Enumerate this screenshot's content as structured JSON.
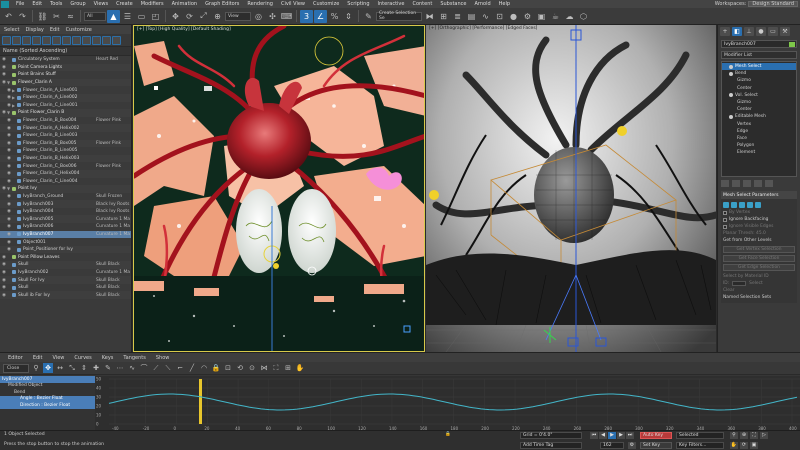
{
  "menubar": {
    "items": [
      "File",
      "Edit",
      "Tools",
      "Group",
      "Views",
      "Create",
      "Modifiers",
      "Animation",
      "Graph Editors",
      "Rendering",
      "Civil View",
      "Customize",
      "Scripting",
      "Interactive",
      "Content",
      "Substance",
      "Arnold",
      "Help"
    ],
    "workspaces_label": "Workspaces:",
    "workspace_value": "Design Standard"
  },
  "toolbar": {
    "filter_value": "All",
    "refcoord_value": "View",
    "selection_set_placeholder": "Create Selection Se"
  },
  "explorer": {
    "menu": [
      "Select",
      "Display",
      "Edit",
      "Customize"
    ],
    "header": "Name (Sorted Ascending)",
    "rows": [
      {
        "name": "Circulatory System",
        "mat": "Heart Red",
        "indent": 0,
        "expand": "",
        "group": false
      },
      {
        "name": "Point Camera Lights",
        "mat": "",
        "indent": 0,
        "expand": "",
        "group": true
      },
      {
        "name": "Point Brains Stuff",
        "mat": "",
        "indent": 0,
        "expand": "",
        "group": true
      },
      {
        "name": "Flower_Clarin A",
        "mat": "",
        "indent": 0,
        "expand": "▼",
        "group": true
      },
      {
        "name": "Flower_Clarin_A_Line001",
        "mat": "",
        "indent": 1,
        "expand": "▶",
        "group": false
      },
      {
        "name": "Flower_Clarin_A_Line002",
        "mat": "",
        "indent": 1,
        "expand": "▶",
        "group": false
      },
      {
        "name": "Flower_Clarin_C_Line001",
        "mat": "",
        "indent": 1,
        "expand": "▶",
        "group": false
      },
      {
        "name": "Point Flower_Clarin B",
        "mat": "",
        "indent": 0,
        "expand": "▼",
        "group": true
      },
      {
        "name": "Flower_Clarin_B_Box004",
        "mat": "Flower Pink",
        "indent": 1,
        "expand": "",
        "group": false
      },
      {
        "name": "Flower_Clarin_A_Helix002",
        "mat": "",
        "indent": 1,
        "expand": "",
        "group": false
      },
      {
        "name": "Flower_Clarin_B_Line003",
        "mat": "",
        "indent": 1,
        "expand": "",
        "group": false
      },
      {
        "name": "Flower_Clarin_B_Box005",
        "mat": "Flower Pink",
        "indent": 1,
        "expand": "",
        "group": false
      },
      {
        "name": "Flower_Clarin_B_Line005",
        "mat": "",
        "indent": 1,
        "expand": "",
        "group": false
      },
      {
        "name": "Flower_Clarin_B_Helix003",
        "mat": "",
        "indent": 1,
        "expand": "",
        "group": false
      },
      {
        "name": "Flower_Clarin_C_Box006",
        "mat": "Flower Pink",
        "indent": 1,
        "expand": "",
        "group": false
      },
      {
        "name": "Flower_Clarin_C_Helix004",
        "mat": "",
        "indent": 1,
        "expand": "",
        "group": false
      },
      {
        "name": "Flower_Clarin_C_Line004",
        "mat": "",
        "indent": 1,
        "expand": "",
        "group": false
      },
      {
        "name": "Point Ivy",
        "mat": "",
        "indent": 0,
        "expand": "▼",
        "group": true
      },
      {
        "name": "IvyBranch_Ground",
        "mat": "Skull Frozen",
        "indent": 1,
        "expand": "",
        "group": false
      },
      {
        "name": "IvyBranch003",
        "mat": "Black Ivy Roots",
        "indent": 1,
        "expand": "",
        "group": false
      },
      {
        "name": "IvyBranch004",
        "mat": "Black Ivy Roots",
        "indent": 1,
        "expand": "",
        "group": false
      },
      {
        "name": "IvyBranch005",
        "mat": "Curvature 1 Ma",
        "indent": 1,
        "expand": "",
        "group": false
      },
      {
        "name": "IvyBranch006",
        "mat": "Curvature 1 Ma",
        "indent": 1,
        "expand": "",
        "group": false
      },
      {
        "name": "IvyBranch007",
        "mat": "Curvature 1 Ma",
        "indent": 1,
        "expand": "",
        "group": false,
        "selected": true
      },
      {
        "name": "Object001",
        "mat": "",
        "indent": 1,
        "expand": "",
        "group": false
      },
      {
        "name": "Point_Positioner for Ivy",
        "mat": "",
        "indent": 1,
        "expand": "",
        "group": false
      },
      {
        "name": "Point Pillow Leaves",
        "mat": "",
        "indent": 0,
        "expand": "",
        "group": true
      },
      {
        "name": "Skull",
        "mat": "Skull Black",
        "indent": 0,
        "expand": "",
        "group": false
      },
      {
        "name": "IvyBranch002",
        "mat": "Curvature 1 Ma",
        "indent": 0,
        "expand": "",
        "group": false
      },
      {
        "name": "Skull For Ivy",
        "mat": "Skull Black",
        "indent": 0,
        "expand": "",
        "group": false
      },
      {
        "name": "Skull",
        "mat": "Skull Black",
        "indent": 0,
        "expand": "",
        "group": false
      },
      {
        "name": "Skull ib For Ivy",
        "mat": "Skull Black",
        "indent": 0,
        "expand": "",
        "group": false
      }
    ]
  },
  "viewports": {
    "left_label": "[+] [Top] [High Quality] [Default Shading]",
    "right_label": "[+] [Orthographic] [Performance] [Edged Faces]"
  },
  "cmdpanel": {
    "object_name": "IvyBranch007",
    "modifier_list": "Modifier List",
    "swatch_color": "#7ec84a",
    "stack": [
      {
        "label": "Mesh Select",
        "level": 0,
        "sel": true
      },
      {
        "label": "Bend",
        "level": 0,
        "sel": false
      },
      {
        "label": "Gizmo",
        "level": 1,
        "sel": false
      },
      {
        "label": "Center",
        "level": 1,
        "sel": false
      },
      {
        "label": "Vol. Select",
        "level": 0,
        "sel": false
      },
      {
        "label": "Gizmo",
        "level": 1,
        "sel": false
      },
      {
        "label": "Center",
        "level": 1,
        "sel": false
      },
      {
        "label": "Editable Mesh",
        "level": 0,
        "sel": false
      },
      {
        "label": "Vertex",
        "level": 1,
        "sel": false
      },
      {
        "label": "Edge",
        "level": 1,
        "sel": false
      },
      {
        "label": "Face",
        "level": 1,
        "sel": false
      },
      {
        "label": "Polygon",
        "level": 1,
        "sel": false
      },
      {
        "label": "Element",
        "level": 1,
        "sel": false
      }
    ],
    "rollout_title": "Mesh Select Parameters",
    "by_vertex": "By Vertex",
    "ignore_backfacing": "Ignore Backfacing",
    "ignore_visible_edges": "Ignore Visible Edges",
    "planar_thresh": "Planar Thresh: 45.0",
    "get_from_other": "Get from Other Levels",
    "get_vertex_sel": "Get Vertex Selection",
    "get_face_sel": "Get Face Selection",
    "get_edge_sel": "Get Edge Selection",
    "select_by_material": "Select by Material ID",
    "id_label": "ID:",
    "select_btn": "Select",
    "clear_label": "Clear",
    "named_selection_sets": "Named Selection Sets"
  },
  "curve_editor": {
    "menu": [
      "Editor",
      "Edit",
      "View",
      "Curves",
      "Keys",
      "Tangents",
      "Show"
    ],
    "close_label": "Close",
    "tree": [
      {
        "label": "IvyBranch007",
        "sel": true,
        "indent": 0
      },
      {
        "label": "Modified Object",
        "sel": false,
        "indent": 1
      },
      {
        "label": "Bend",
        "sel": false,
        "indent": 2
      },
      {
        "label": "Angle : Bezier Float",
        "sel": true,
        "indent": 3
      },
      {
        "label": "Direction : Bezier Float",
        "sel": true,
        "indent": 3
      }
    ],
    "y_ticks": [
      "50",
      "40",
      "30",
      "20",
      "10",
      "0"
    ],
    "x_ticks": [
      "-40",
      "-20",
      "0",
      "20",
      "40",
      "60",
      "80",
      "100",
      "120",
      "140",
      "160",
      "180",
      "200",
      "220",
      "240",
      "260",
      "280",
      "300",
      "320",
      "340",
      "360",
      "380",
      "400"
    ],
    "curve_color": "#43b6c9"
  },
  "status": {
    "objects_selected": "1 Object Selected",
    "prompt": "Press the stop button to stop the animation",
    "grid": "Grid = 0'4.0\"",
    "add_time_tag": "Add Time Tag",
    "auto_key": "Auto Key",
    "selected_label": "Selected",
    "set_key": "Set Key",
    "key_filters": "Key Filters...",
    "frame": "162",
    "auto_key_color": "#b83a3a"
  }
}
